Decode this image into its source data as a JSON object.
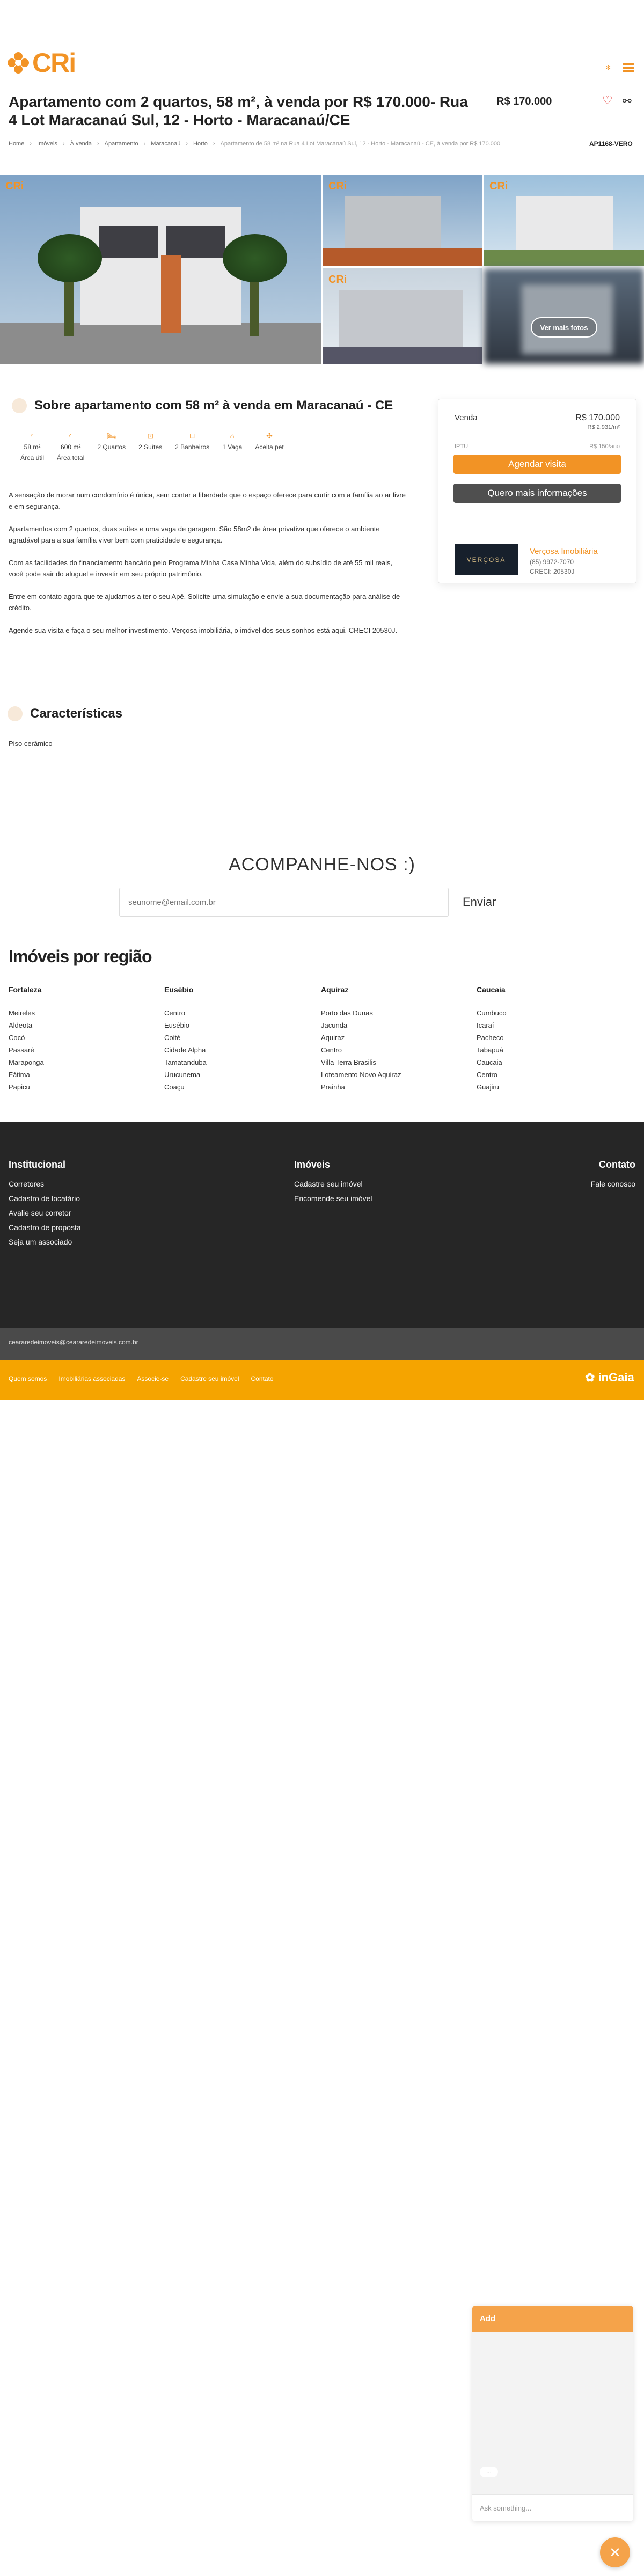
{
  "brand": {
    "logo_text": "CRi",
    "accent": "#f29325"
  },
  "header": {
    "lang_icon": "language-icon",
    "menu_icon": "hamburger-icon"
  },
  "listing": {
    "title": "Apartamento com 2 quartos, 58 m², à venda por R$ 170.000- Rua 4 Lot Maracanaú Sul, 12 - Horto - Maracanaú/CE",
    "price": "R$ 170.000",
    "ref": "AP1168-VERO"
  },
  "breadcrumb": [
    "Home",
    "Imóveis",
    "À venda",
    "Apartamento",
    "Maracanaú",
    "Horto",
    "Apartamento de 58 m² na Rua 4 Lot Maracanaú Sul, 12 - Horto - Maracanaú - CE, à venda por R$ 170.000"
  ],
  "gallery": {
    "more_label": "Ver mais fotos",
    "watermark": "CRi"
  },
  "about": {
    "title": "Sobre apartamento com 58 m² à venda em Maracanaú - CE",
    "features": [
      {
        "icon": "area-icon",
        "value": "58 m²",
        "label": "Área útil"
      },
      {
        "icon": "total-area-icon",
        "value": "600 m²",
        "label": "Área total"
      },
      {
        "icon": "bed-icon",
        "value": "",
        "label": "2 Quartos"
      },
      {
        "icon": "suite-icon",
        "value": "",
        "label": "2 Suítes"
      },
      {
        "icon": "bath-icon",
        "value": "",
        "label": "2 Banheiros"
      },
      {
        "icon": "car-icon",
        "value": "",
        "label": "1 Vaga"
      },
      {
        "icon": "pet-icon",
        "value": "",
        "label": "Aceita pet"
      }
    ],
    "paragraphs": [
      "A sensação de morar num condomínio é única, sem contar a liberdade que o espaço oferece para curtir com a família ao ar livre e em segurança.",
      "Apartamentos com 2 quartos, duas suítes e uma vaga de garagem. São 58m2 de área privativa que oferece o ambiente agradável para a sua família viver bem com praticidade e segurança.",
      "Com as facilidades do financiamento bancário pelo Programa Minha Casa Minha Vida, além do subsídio de até 55 mil reais, você pode sair do aluguel e investir em seu próprio patrimônio.",
      "Entre em contato agora que te ajudamos a ter o seu Apê. Solicite uma simulação e envie a sua documentação para análise de crédito.",
      "Agende sua visita e faça o seu melhor investimento. Verçosa imobiliária, o imóvel dos seus sonhos está aqui. CRECI 20530J."
    ]
  },
  "card": {
    "sale_label": "Venda",
    "sale_price": "R$ 170.000",
    "price_per_m2": "R$ 2.931/m²",
    "iptu_label": "IPTU",
    "iptu_value": "R$ 150/ano",
    "schedule_btn": "Agendar visita",
    "info_btn": "Quero mais informações",
    "agency_logo": "VERÇOSA",
    "agency_name": "Verçosa Imobiliária",
    "agency_phone": "(85) 9972-7070",
    "agency_creci": "CRECI: 20530J"
  },
  "characteristics": {
    "title": "Características",
    "items": [
      "Piso cerâmico"
    ]
  },
  "newsletter": {
    "heading": "ACOMPANHE-NOS :)",
    "placeholder": "seunome@email.com.br",
    "button": "Enviar"
  },
  "regions": {
    "title": "Imóveis por região",
    "columns": [
      {
        "heading": "Fortaleza",
        "items": [
          "Meireles",
          "Aldeota",
          "Cocó",
          "Passaré",
          "Maraponga",
          "Fátima",
          "Papicu"
        ]
      },
      {
        "heading": "Eusébio",
        "items": [
          "Centro",
          "Eusébio",
          "Coité",
          "Cidade Alpha",
          "Tamatanduba",
          "Urucunema",
          "Coaçu"
        ]
      },
      {
        "heading": "Aquiraz",
        "items": [
          "Porto das Dunas",
          "Jacunda",
          "Aquiraz",
          "Centro",
          "Villa Terra Brasilis",
          "Loteamento Novo Aquiraz",
          "Prainha"
        ]
      },
      {
        "heading": "Caucaia",
        "items": [
          "Cumbuco",
          "Icaraí",
          "Pacheco",
          "Tabapuá",
          "Caucaia",
          "Centro",
          "Guajiru"
        ]
      }
    ]
  },
  "footer": {
    "institucional": {
      "heading": "Institucional",
      "items": [
        "Corretores",
        "Cadastro de locatário",
        "Avalie seu corretor",
        "Cadastro de proposta",
        "Seja um associado"
      ]
    },
    "imoveis": {
      "heading": "Imóveis",
      "items": [
        "Cadastre seu imóvel",
        "Encomende seu imóvel"
      ]
    },
    "contato": {
      "heading": "Contato",
      "items": [
        "Fale conosco"
      ]
    },
    "email": "ceararedeimoveis@ceararedeimoveis.com.br",
    "links": [
      "Quem somos",
      "Imobiliárias associadas",
      "Associe-se",
      "Cadastre seu imóvel",
      "Contato"
    ],
    "powered_by": "inGaia"
  },
  "chat": {
    "header": "Add",
    "bubble": "...",
    "placeholder": "Ask something..."
  }
}
